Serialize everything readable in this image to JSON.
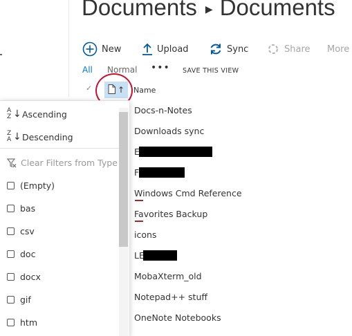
{
  "breadcrumb": {
    "parts": [
      "Documents",
      "Documents"
    ]
  },
  "commands": {
    "new": "New",
    "upload": "Upload",
    "sync": "Sync",
    "share": "Share",
    "more": "More"
  },
  "views": {
    "all": "All",
    "normal": "Normal",
    "more": "•••",
    "save": "SAVE THIS VIEW"
  },
  "header": {
    "check": "✓",
    "type_arrow": "↑",
    "name": "Name"
  },
  "files": [
    "Docs-n-Notes",
    "Downloads sync",
    "E",
    "F",
    "Windows Cmd Reference",
    "Favorites Backup",
    "icons",
    "LE",
    "MobaXterm_old",
    "Notepad++ stuff",
    "OneNote Notebooks"
  ],
  "menu": {
    "ascending": "Ascending",
    "descending": "Descending",
    "clear_filters": "Clear Filters from Type",
    "sort_az_top": "A",
    "sort_az_bottom": "Z",
    "sort_za_top": "Z",
    "sort_za_bottom": "A",
    "options": [
      "(Empty)",
      "bas",
      "csv",
      "doc",
      "docx",
      "gif",
      "htm"
    ]
  },
  "colors": {
    "accent": "#0078d4",
    "highlight": "#c7e0f4",
    "circle": "#c8102e"
  }
}
